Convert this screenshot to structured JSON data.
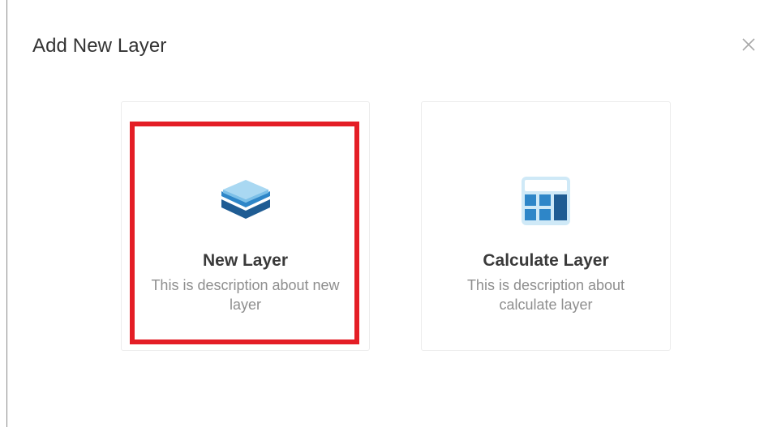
{
  "dialog": {
    "title": "Add New Layer",
    "close_symbol": "×"
  },
  "options": [
    {
      "title": "New Layer",
      "description": "This is description about new layer",
      "icon": "layers-icon",
      "selected": true
    },
    {
      "title": "Calculate Layer",
      "description": "This is description about calculate layer",
      "icon": "calculator-icon",
      "selected": false
    }
  ],
  "colors": {
    "highlight": "#e41e26",
    "icon_dark": "#1f5c93",
    "icon_mid": "#2e86c8",
    "icon_light": "#a9d8f2"
  }
}
